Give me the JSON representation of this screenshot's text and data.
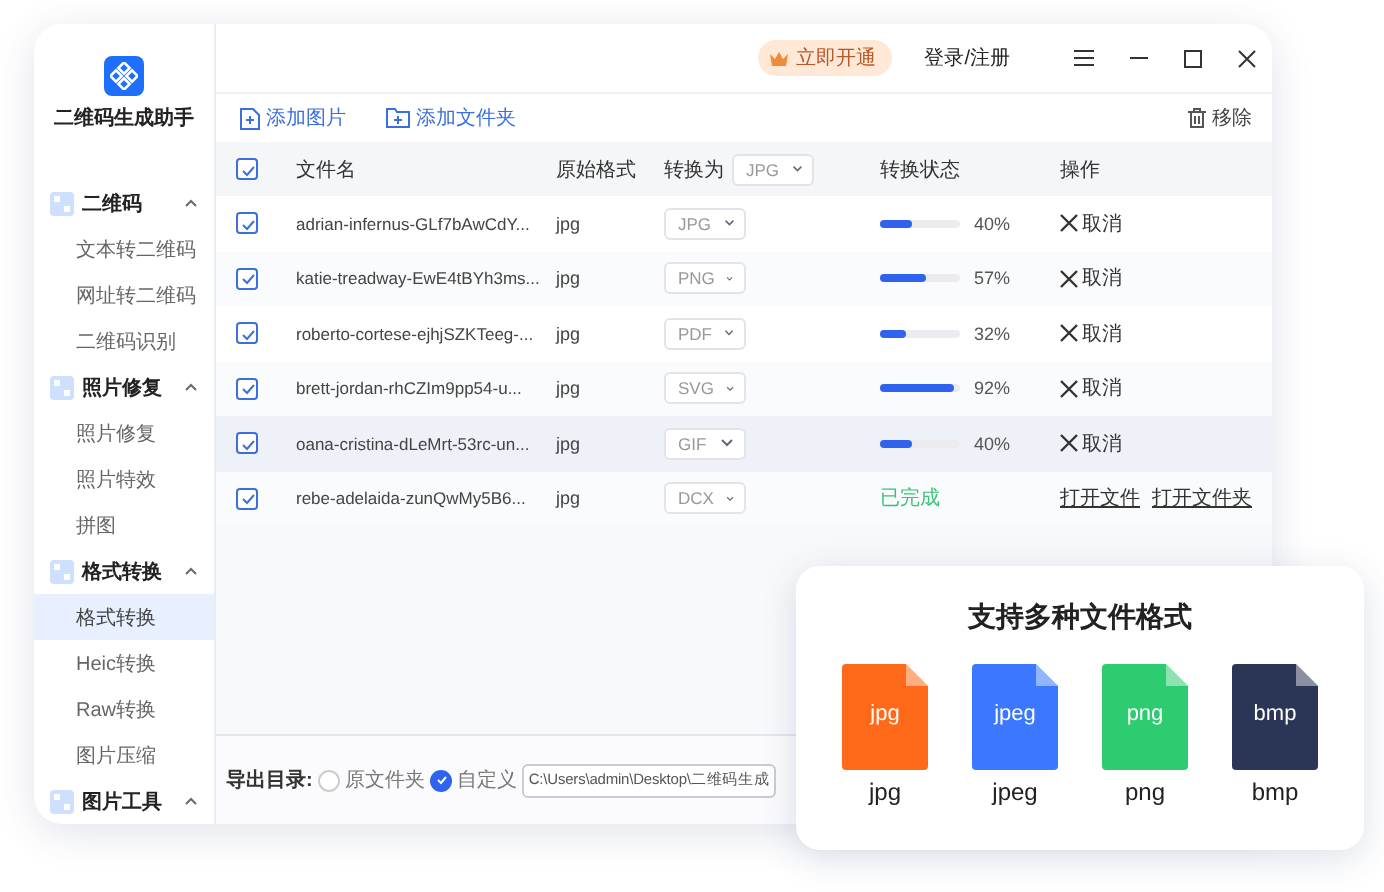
{
  "app": {
    "title": "二维码生成助手"
  },
  "header": {
    "vip_button": "立即开通",
    "login": "登录/注册"
  },
  "sidebar": {
    "groups": [
      {
        "label": "二维码",
        "expanded": true,
        "items": [
          {
            "label": "文本转二维码",
            "selected": false
          },
          {
            "label": "网址转二维码",
            "selected": false
          },
          {
            "label": "二维码识别",
            "selected": false
          }
        ]
      },
      {
        "label": "照片修复",
        "expanded": true,
        "items": [
          {
            "label": "照片修复",
            "selected": false
          },
          {
            "label": "照片特效",
            "selected": false
          },
          {
            "label": "拼图",
            "selected": false
          }
        ]
      },
      {
        "label": "格式转换",
        "expanded": true,
        "items": [
          {
            "label": "格式转换",
            "selected": true
          },
          {
            "label": "Heic转换",
            "selected": false
          },
          {
            "label": "Raw转换",
            "selected": false
          },
          {
            "label": "图片压缩",
            "selected": false
          }
        ]
      },
      {
        "label": "图片工具",
        "expanded": true
      }
    ]
  },
  "toolbar": {
    "add_image": "添加图片",
    "add_folder": "添加文件夹",
    "remove": "移除"
  },
  "table": {
    "header_checked": true,
    "columns": [
      "文件名",
      "原始格式",
      "转换为",
      "转换状态",
      "操作"
    ],
    "target_all": "JPG",
    "rows": [
      {
        "checked": true,
        "selected": false,
        "name": "adrian-infernus-GLf7bAwCdY...",
        "format": "jpg",
        "target": "JPG",
        "status": {
          "kind": "progress",
          "level": 0.4,
          "reading": "40%"
        },
        "actions": [
          {
            "kind": "cancel",
            "label": "取消"
          }
        ]
      },
      {
        "checked": true,
        "selected": false,
        "name": "katie-treadway-EwE4tBYh3ms...",
        "format": "jpg",
        "target": "PNG",
        "status": {
          "kind": "progress",
          "level": 0.57,
          "reading": "57%"
        },
        "actions": [
          {
            "kind": "cancel",
            "label": "取消"
          }
        ]
      },
      {
        "checked": true,
        "selected": false,
        "name": "roberto-cortese-ejhjSZKTeeg-...",
        "format": "jpg",
        "target": "PDF",
        "status": {
          "kind": "progress",
          "level": 0.32,
          "reading": "32%"
        },
        "actions": [
          {
            "kind": "cancel",
            "label": "取消"
          }
        ]
      },
      {
        "checked": true,
        "selected": false,
        "name": "brett-jordan-rhCZIm9pp54-u...",
        "format": "jpg",
        "target": "SVG",
        "status": {
          "kind": "progress",
          "level": 0.92,
          "reading": "92%"
        },
        "actions": [
          {
            "kind": "cancel",
            "label": "取消"
          }
        ]
      },
      {
        "checked": true,
        "selected": true,
        "name": "oana-cristina-dLeMrt-53rc-un...",
        "format": "jpg",
        "target": "GIF",
        "status": {
          "kind": "progress",
          "level": 0.4,
          "reading": "40%"
        },
        "actions": [
          {
            "kind": "cancel",
            "label": "取消"
          }
        ]
      },
      {
        "checked": true,
        "selected": false,
        "name": "rebe-adelaida-zunQwMy5B6...",
        "format": "jpg",
        "target": "DCX",
        "status": {
          "kind": "done",
          "text": "已完成"
        },
        "actions": [
          {
            "kind": "link",
            "label": "打开文件"
          },
          {
            "kind": "link",
            "label": "打开文件夹"
          }
        ]
      }
    ]
  },
  "export": {
    "label": "导出目录:",
    "options": [
      {
        "label": "原文件夹",
        "selected": false
      },
      {
        "label": "自定义",
        "selected": true
      }
    ],
    "path": "C:\\Users\\admin\\Desktop\\二维码生成"
  },
  "formats_card": {
    "title": "支持多种文件格式",
    "formats": [
      {
        "icon_label": "jpg",
        "label": "jpg",
        "color": "#ff6a1a"
      },
      {
        "icon_label": "jpeg",
        "label": "jpeg",
        "color": "#3b78ff"
      },
      {
        "icon_label": "png",
        "label": "png",
        "color": "#2ecc71"
      },
      {
        "icon_label": "bmp",
        "label": "bmp",
        "color": "#2b3556"
      }
    ]
  }
}
